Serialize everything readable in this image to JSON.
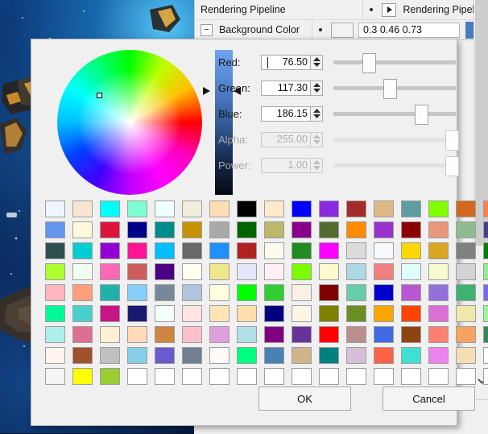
{
  "window": {
    "background_scene": "3d-space-nebula-viewport"
  },
  "property_panel": {
    "rows": [
      {
        "expander": "collapse-arrow",
        "label": "Rendering Pipeline",
        "right_label": "Rendering Pipeline",
        "value": "",
        "has_chip": false
      },
      {
        "expander": "minus",
        "label": "Background Color",
        "right_label": "",
        "value": "0.3 0.46 0.73",
        "has_chip": true,
        "chip_color": "#4a7ebb"
      }
    ],
    "scrollbar": {
      "down_arrow_icon": "chevron-down-icon"
    }
  },
  "color_dialog": {
    "wheel": {
      "marker_label": "color-wheel-marker"
    },
    "value_bar": {
      "top_color": "#6fa3f0",
      "bottom_color": "#050a14"
    },
    "channels": [
      {
        "name": "red",
        "label": "Red:",
        "value": "76.50",
        "enabled": true,
        "slider_pct": 30.0,
        "focused": true
      },
      {
        "name": "green",
        "label": "Green:",
        "value": "117.30",
        "enabled": true,
        "slider_pct": 46.0,
        "focused": false
      },
      {
        "name": "blue",
        "label": "Blue:",
        "value": "186.15",
        "enabled": true,
        "slider_pct": 73.0,
        "focused": false
      },
      {
        "name": "alpha",
        "label": "Alpha:",
        "value": "255.00",
        "enabled": false,
        "slider_pct": 100.0,
        "focused": false
      },
      {
        "name": "power",
        "label": "Power:",
        "value": "1.00",
        "enabled": false,
        "slider_pct": 100.0,
        "focused": false
      }
    ],
    "swatch_grid": {
      "columns": 17,
      "rows": 9,
      "colors": [
        [
          "#edf5ff",
          "#fae5d3",
          "#00ffff",
          "#7fffd4",
          "#f0ffff",
          "#f0eedb",
          "#ffdeb5",
          "#000000",
          "#ffe9cc",
          "#0000ff",
          "#8a2be2",
          "#a52a2a",
          "#deb887",
          "#5f9ea0",
          "#7fff00",
          "#d2691e",
          "#ff7f50"
        ],
        [
          "#6495ed",
          "#fff8dc",
          "#dc143c",
          "#00008b",
          "#008b8b",
          "#c69200",
          "#a9a9a9",
          "#006400",
          "#bdb76b",
          "#8b008b",
          "#556b2f",
          "#ff8c00",
          "#9932cc",
          "#8b0000",
          "#e9967a",
          "#8fbc8f",
          "#483d8b"
        ],
        [
          "#2f4f4f",
          "#00ced1",
          "#9400d3",
          "#ff1493",
          "#00bfff",
          "#696969",
          "#1e90ff",
          "#b22222",
          "#fffaf0",
          "#228b22",
          "#ff00ff",
          "#dcdcdc",
          "#f8f8ff",
          "#ffd700",
          "#daa520",
          "#808080",
          "#008000"
        ],
        [
          "#adff2f",
          "#f0fff0",
          "#ff69b4",
          "#cd5c5c",
          "#4b0082",
          "#fffff0",
          "#f0e68c",
          "#e6e6fa",
          "#fff0f5",
          "#7cfc00",
          "#fffacd",
          "#add8e6",
          "#f08080",
          "#e0ffff",
          "#fafad2",
          "#d3d3d3",
          "#90ee90"
        ],
        [
          "#ffb6c1",
          "#ffa07a",
          "#20b2aa",
          "#87cefa",
          "#778899",
          "#b0c4de",
          "#ffffe0",
          "#00ff00",
          "#32cd32",
          "#faf0e6",
          "#800000",
          "#66cdaa",
          "#0000cd",
          "#ba55d3",
          "#9370db",
          "#3cb371",
          "#7b68ee"
        ],
        [
          "#00fa9a",
          "#48d1cc",
          "#c71585",
          "#191970",
          "#f5fffa",
          "#ffe4e1",
          "#ffe4b5",
          "#ffdead",
          "#000080",
          "#fdf5e6",
          "#808000",
          "#6b8e23",
          "#ffa500",
          "#ff4500",
          "#da70d6",
          "#eee8aa",
          "#98fb98"
        ],
        [
          "#afeeee",
          "#db7093",
          "#ffefd5",
          "#ffdab9",
          "#cd853f",
          "#ffc0cb",
          "#dda0dd",
          "#b0e0e6",
          "#800080",
          "#663399",
          "#ff0000",
          "#bc8f8f",
          "#4169e1",
          "#8b4513",
          "#fa8072",
          "#f4a460",
          "#2e8b57"
        ],
        [
          "#fff5ee",
          "#a0522d",
          "#c0c0c0",
          "#87ceeb",
          "#6a5acd",
          "#708090",
          "#fffafa",
          "#00ff7f",
          "#4682b4",
          "#d2b48c",
          "#008080",
          "#d8bfd8",
          "#ff6347",
          "#40e0d0",
          "#ee82ee",
          "#f5deb3",
          "#ffffff"
        ],
        [
          "#f5f5f5",
          "#ffff00",
          "#9acd32",
          "#ffffff",
          "#ffffff",
          "#ffffff",
          "#ffffff",
          "#ffffff",
          "#ffffff",
          "#ffffff",
          "#ffffff",
          "#ffffff",
          "#ffffff",
          "#ffffff",
          "#ffffff",
          "#ffffff",
          "#ffffff"
        ]
      ]
    },
    "buttons": {
      "ok_label": "OK",
      "cancel_label": "Cancel"
    }
  }
}
